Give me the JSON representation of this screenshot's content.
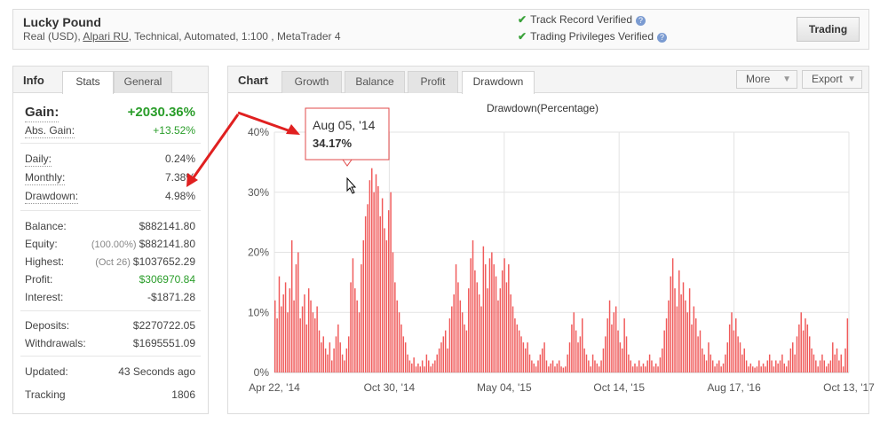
{
  "header": {
    "title": "Lucky Pound",
    "sub_prefix": "Real (USD), ",
    "broker": "Alpari RU",
    "sub_suffix": ", Technical, Automated, 1:100 , MetaTrader 4",
    "verified1": "Track Record Verified",
    "verified2": "Trading Privileges Verified",
    "trading_button": "Trading"
  },
  "info": {
    "label": "Info",
    "tabs": [
      "Stats",
      "General"
    ],
    "gain_label": "Gain:",
    "gain_value": "+2030.36%",
    "abs_gain_label": "Abs. Gain:",
    "abs_gain_value": "+13.52%",
    "daily_label": "Daily:",
    "daily_value": "0.24%",
    "monthly_label": "Monthly:",
    "monthly_value": "7.38%",
    "drawdown_label": "Drawdown:",
    "drawdown_value": "4.98%",
    "balance_label": "Balance:",
    "balance_value": "$882141.80",
    "equity_label": "Equity:",
    "equity_note": "(100.00%)",
    "equity_value": "$882141.80",
    "highest_label": "Highest:",
    "highest_note": "(Oct 26)",
    "highest_value": "$1037652.29",
    "profit_label": "Profit:",
    "profit_value": "$306970.84",
    "interest_label": "Interest:",
    "interest_value": "-$1871.28",
    "deposits_label": "Deposits:",
    "deposits_value": "$2270722.05",
    "withdrawals_label": "Withdrawals:",
    "withdrawals_value": "$1695551.09",
    "updated_label": "Updated:",
    "updated_value": "43 Seconds ago",
    "tracking_label": "Tracking",
    "tracking_value": "1806"
  },
  "chart_panel": {
    "label": "Chart",
    "tabs": [
      "Growth",
      "Balance",
      "Profit",
      "Drawdown"
    ],
    "active_tab": "Drawdown",
    "more_label": "More",
    "export_label": "Export"
  },
  "tooltip": {
    "date": "Aug 05, '14",
    "value": "34.17%"
  },
  "colors": {
    "bar": "#f05a5a",
    "gain_green": "#2a9d2a",
    "arrow_red": "#e02020",
    "check_green": "#3aa23a"
  },
  "chart_data": {
    "type": "bar",
    "title": "Drawdown(Percentage)",
    "yticks": [
      "40%",
      "30%",
      "20%",
      "10%",
      "0%"
    ],
    "xticks": [
      "Apr 22, '14",
      "Oct 30, '14",
      "May 04, '15",
      "Oct 14, '15",
      "Aug 17, '16",
      "Oct 13, '17"
    ],
    "ylim": [
      0,
      40
    ],
    "grid": true,
    "values": [
      12,
      9,
      16,
      11,
      13,
      15,
      10,
      14,
      22,
      12,
      18,
      20,
      9,
      11,
      13,
      8,
      14,
      12,
      10,
      9,
      11,
      7,
      5,
      6,
      4,
      3,
      5,
      2,
      4,
      6,
      8,
      5,
      3,
      2,
      4,
      6,
      15,
      19,
      14,
      12,
      10,
      18,
      22,
      26,
      28,
      32,
      34,
      30,
      33,
      31,
      26,
      29,
      24,
      22,
      27,
      30,
      20,
      15,
      12,
      10,
      8,
      6,
      5,
      3,
      2,
      1.5,
      2.5,
      1,
      1.5,
      1,
      2,
      1,
      3,
      2,
      1,
      1.5,
      2,
      3,
      4,
      5,
      6,
      7,
      4,
      9,
      11,
      13,
      18,
      15,
      12,
      10,
      8,
      7,
      14,
      19,
      22,
      17,
      15,
      13,
      11,
      21,
      18,
      14,
      19,
      20,
      18,
      16,
      12,
      14,
      17,
      19,
      15,
      18,
      13,
      11,
      9,
      8,
      7,
      6,
      5,
      4,
      5,
      3,
      2,
      1.5,
      1,
      2,
      3,
      4,
      5,
      2,
      1,
      1.5,
      2,
      1,
      1.5,
      2,
      1,
      0.8,
      1,
      3,
      5,
      8,
      10,
      7,
      5,
      6,
      9,
      4,
      3,
      2,
      1,
      3,
      2,
      1.5,
      1,
      2,
      4,
      6,
      9,
      12,
      8,
      10,
      11,
      7,
      5,
      4,
      9,
      6,
      3,
      2,
      1,
      1.5,
      1,
      2,
      1,
      1.5,
      1,
      2,
      3,
      2,
      1,
      1.5,
      1,
      2.5,
      4,
      7,
      9,
      12,
      16,
      19,
      14,
      11,
      17,
      13,
      15,
      12,
      10,
      14,
      8,
      11,
      9,
      6,
      7,
      4,
      3,
      2,
      5,
      3,
      2,
      1,
      1.5,
      2,
      1,
      1.5,
      3,
      5,
      8,
      10,
      7,
      9,
      6,
      5,
      3,
      4,
      2,
      1,
      1.5,
      1,
      0.8,
      1,
      2,
      1,
      1.5,
      1,
      2,
      3,
      2,
      1,
      2,
      1.5,
      2,
      3,
      1.5,
      1,
      2,
      4,
      5,
      3,
      6,
      8,
      10,
      7,
      9,
      8,
      6,
      4,
      3,
      2,
      1,
      2,
      3,
      2,
      1,
      1.5,
      2,
      5,
      3,
      4,
      2,
      3,
      1,
      4,
      9
    ]
  }
}
